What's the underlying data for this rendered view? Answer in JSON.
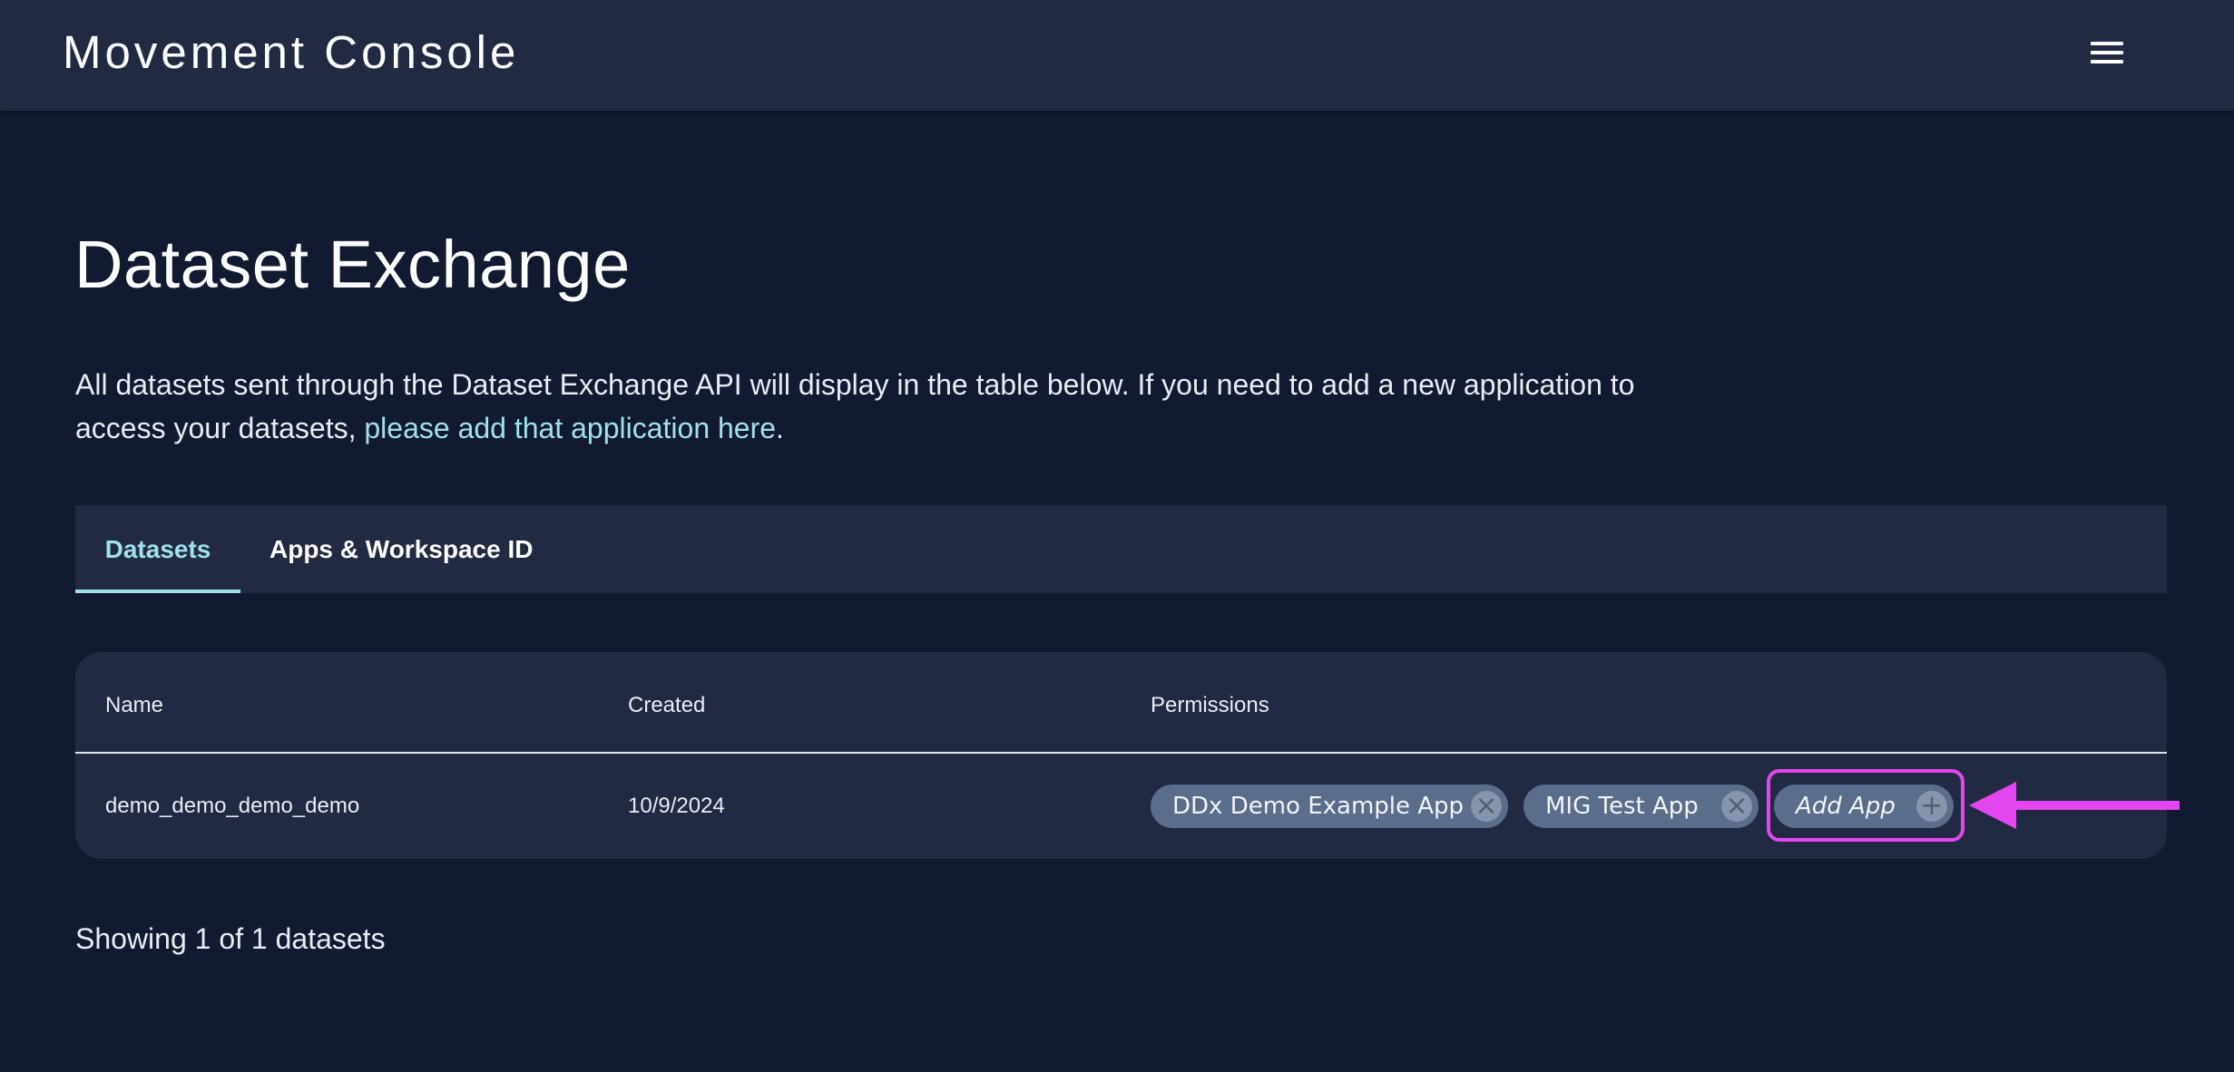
{
  "header": {
    "brand": "Movement Console",
    "menu_icon": "hamburger-menu-icon"
  },
  "main": {
    "title": "Dataset Exchange",
    "intro_text": "All datasets sent through the Dataset Exchange API will display in the table below. If you need to add a new application to access your datasets, ",
    "intro_link": "please add that application here",
    "intro_end": "."
  },
  "tabs": [
    {
      "label": "Datasets",
      "active": true
    },
    {
      "label": "Apps & Workspace ID",
      "active": false
    }
  ],
  "table": {
    "columns": [
      "Name",
      "Created",
      "Permissions"
    ],
    "rows": [
      {
        "name": "demo_demo_demo_demo",
        "created": "10/9/2024",
        "permissions": [
          "DDx Demo Example App",
          "MIG Test App"
        ],
        "add_label": "Add App"
      }
    ]
  },
  "footer": {
    "count_text": "Showing 1 of 1 datasets"
  },
  "icons": {
    "remove": "×",
    "add": "+"
  },
  "colors": {
    "accent": "#9fe1ec",
    "annotation": "#e346ef",
    "pill": "#5a6d8a"
  }
}
